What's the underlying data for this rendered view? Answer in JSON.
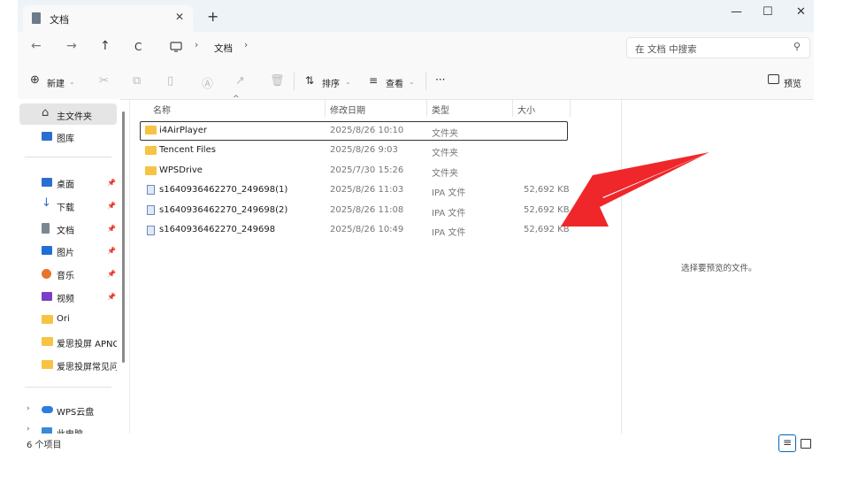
{
  "window": {
    "tab_title": "文档",
    "tab_close": "✕",
    "new_tab": "+",
    "minimize": "—",
    "maximize": "☐",
    "close": "✕"
  },
  "nav": {
    "back": "←",
    "forward": "→",
    "up": "↑",
    "refresh": "C",
    "breadcrumb": [
      "文档"
    ],
    "search_placeholder": "在 文档 中搜索"
  },
  "toolbar": {
    "new_label": "新建",
    "sort_label": "排序",
    "view_label": "查看",
    "more_label": "···",
    "preview_label": "预览"
  },
  "sidebar": {
    "items": [
      {
        "label": "主文件夹",
        "icon": "home-icon",
        "selected": true
      },
      {
        "label": "图库",
        "icon": "gallery-icon"
      },
      {
        "label": "桌面",
        "icon": "desktop-icon",
        "pinned": true
      },
      {
        "label": "下载",
        "icon": "download-icon",
        "pinned": true
      },
      {
        "label": "文档",
        "icon": "document-icon",
        "pinned": true
      },
      {
        "label": "图片",
        "icon": "pictures-icon",
        "pinned": true
      },
      {
        "label": "音乐",
        "icon": "music-icon",
        "pinned": true
      },
      {
        "label": "视频",
        "icon": "video-icon",
        "pinned": true
      },
      {
        "label": "Ori",
        "icon": "folder-icon"
      },
      {
        "label": "爱思投屏 APNG",
        "icon": "folder-icon"
      },
      {
        "label": "爱思投屏常见问",
        "icon": "folder-icon"
      },
      {
        "label": "WPS云盘",
        "icon": "cloud-icon"
      },
      {
        "label": "此电脑",
        "icon": "computer-icon"
      }
    ]
  },
  "columns": {
    "name": "名称",
    "date": "修改日期",
    "type": "类型",
    "size": "大小"
  },
  "files": [
    {
      "name": "i4AirPlayer",
      "date": "2025/8/26 10:10",
      "type": "文件夹",
      "size": "",
      "kind": "folder"
    },
    {
      "name": "Tencent Files",
      "date": "2025/8/26 9:03",
      "type": "文件夹",
      "size": "",
      "kind": "folder"
    },
    {
      "name": "WPSDrive",
      "date": "2025/7/30 15:26",
      "type": "文件夹",
      "size": "",
      "kind": "folder"
    },
    {
      "name": "s1640936462270_249698(1)",
      "date": "2025/8/26 11:03",
      "type": "IPA 文件",
      "size": "52,692 KB",
      "kind": "ipa"
    },
    {
      "name": "s1640936462270_249698(2)",
      "date": "2025/8/26 11:08",
      "type": "IPA 文件",
      "size": "52,692 KB",
      "kind": "ipa"
    },
    {
      "name": "s1640936462270_249698",
      "date": "2025/8/26 10:49",
      "type": "IPA 文件",
      "size": "52,692 KB",
      "kind": "ipa"
    }
  ],
  "preview": {
    "message": "选择要预览的文件。"
  },
  "status": {
    "count": "6 个项目"
  },
  "colors": {
    "accent": "#0067c0",
    "arrow": "#f0272a",
    "folder": "#f6c343",
    "chrome": "#eef3f8"
  }
}
